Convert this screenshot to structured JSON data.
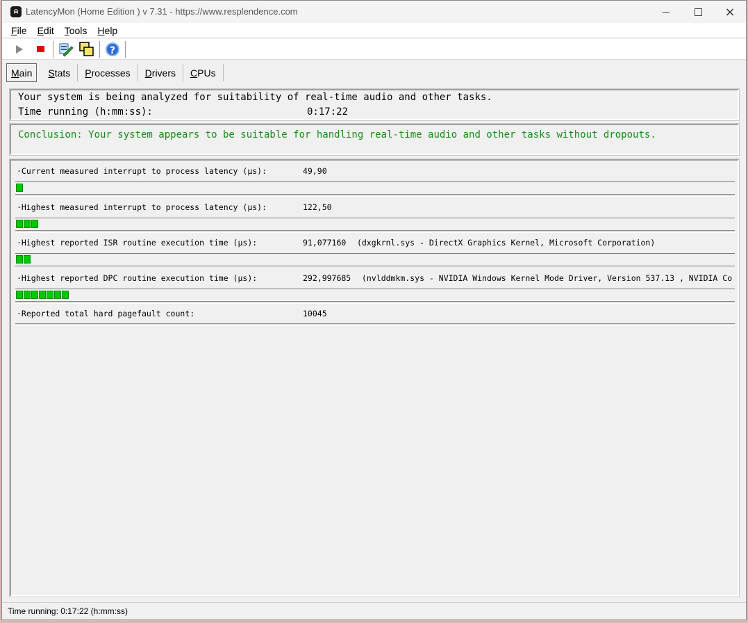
{
  "window": {
    "title": "LatencyMon  (Home Edition )  v 7.31 - https://www.resplendence.com",
    "icon_glyph": "⍝",
    "minimize": "minimize",
    "maximize": "maximize",
    "close": "×"
  },
  "menu": [
    {
      "label_first": "F",
      "label_rest": "ile"
    },
    {
      "label_first": "E",
      "label_rest": "dit"
    },
    {
      "label_first": "T",
      "label_rest": "ools"
    },
    {
      "label_first": "H",
      "label_rest": "elp"
    }
  ],
  "toolbar": {
    "icons": [
      "play-icon",
      "stop-icon",
      "report-icon",
      "copy-windows-icon",
      "help-icon"
    ],
    "help_glyph": "?"
  },
  "tabs": [
    {
      "label_first": "M",
      "label_rest": "ain",
      "active": true
    },
    {
      "label_first": "S",
      "label_rest": "tats"
    },
    {
      "label_first": "P",
      "label_rest": "rocesses"
    },
    {
      "label_first": "D",
      "label_rest": "rivers"
    },
    {
      "label_first": "C",
      "label_rest": "PUs"
    }
  ],
  "status": {
    "line1": "Your system is being analyzed for suitability of real-time audio and other tasks.",
    "line2_label": "Time running (h:mm:ss):",
    "line2_value": "0:17:22"
  },
  "conclusion": "Conclusion: Your system appears to be suitable for handling real-time audio and other tasks without dropouts.",
  "metrics": [
    {
      "label": "·Current measured interrupt to process latency (µs):",
      "value": "49,90",
      "extra": "",
      "bar_segments": 1
    },
    {
      "label": "·Highest measured interrupt to process latency (µs):",
      "value": "122,50",
      "extra": "",
      "bar_segments": 3
    },
    {
      "label": "·Highest reported ISR routine execution time (µs):",
      "value": "91,077160",
      "extra": "(dxgkrnl.sys - DirectX Graphics Kernel, Microsoft Corporation)",
      "bar_segments": 2
    },
    {
      "label": "·Highest reported DPC routine execution time (µs):",
      "value": "292,997685",
      "extra": "(nvlddmkm.sys - NVIDIA Windows Kernel Mode Driver, Version 537.13 , NVIDIA Co",
      "bar_segments": 7
    },
    {
      "label": "·Reported total hard pagefault count:",
      "value": "10045",
      "extra": "",
      "bar_segments": 0
    }
  ],
  "statusbar": "Time running: 0:17:22  (h:mm:ss)",
  "colors": {
    "bar_green": "#00c800",
    "conclusion_green": "#1a8a1a",
    "stop_red": "#e00000",
    "help_blue": "#2a6bd6"
  }
}
